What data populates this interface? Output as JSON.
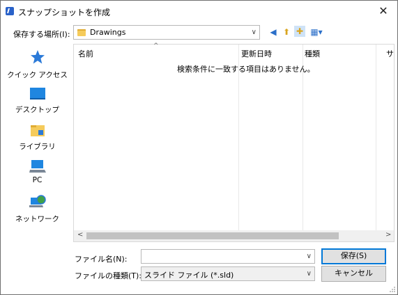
{
  "window": {
    "title": "スナップショットを作成",
    "close_glyph": "✕"
  },
  "location": {
    "label": "保存する場所(I):",
    "value": "Drawings"
  },
  "toolbar": {
    "back_glyph": "◀",
    "up_glyph": "⬆",
    "new_folder_glyph": "✚",
    "view_glyph": "▦▾"
  },
  "places": [
    {
      "label": "クイック アクセス",
      "icon": "star-icon"
    },
    {
      "label": "デスクトップ",
      "icon": "desktop-icon"
    },
    {
      "label": "ライブラリ",
      "icon": "library-icon"
    },
    {
      "label": "PC",
      "icon": "pc-icon"
    },
    {
      "label": "ネットワーク",
      "icon": "network-icon"
    }
  ],
  "list": {
    "columns": [
      "名前",
      "更新日時",
      "種類",
      "サ"
    ],
    "sort_glyph": "^",
    "empty_message": "検索条件に一致する項目はありません。",
    "scroll_left": "<",
    "scroll_right": ">"
  },
  "filename": {
    "label": "ファイル名(N):",
    "value": "",
    "arrow": "∨"
  },
  "filetype": {
    "label": "ファイルの種類(T):",
    "value": "スライド ファイル (*.sld)",
    "arrow": "∨"
  },
  "buttons": {
    "save": "保存(S)",
    "cancel": "キャンセル"
  },
  "colors": {
    "accent": "#0078d7",
    "folder": "#f5cb5b",
    "icon_blue": "#2b7ad8"
  }
}
